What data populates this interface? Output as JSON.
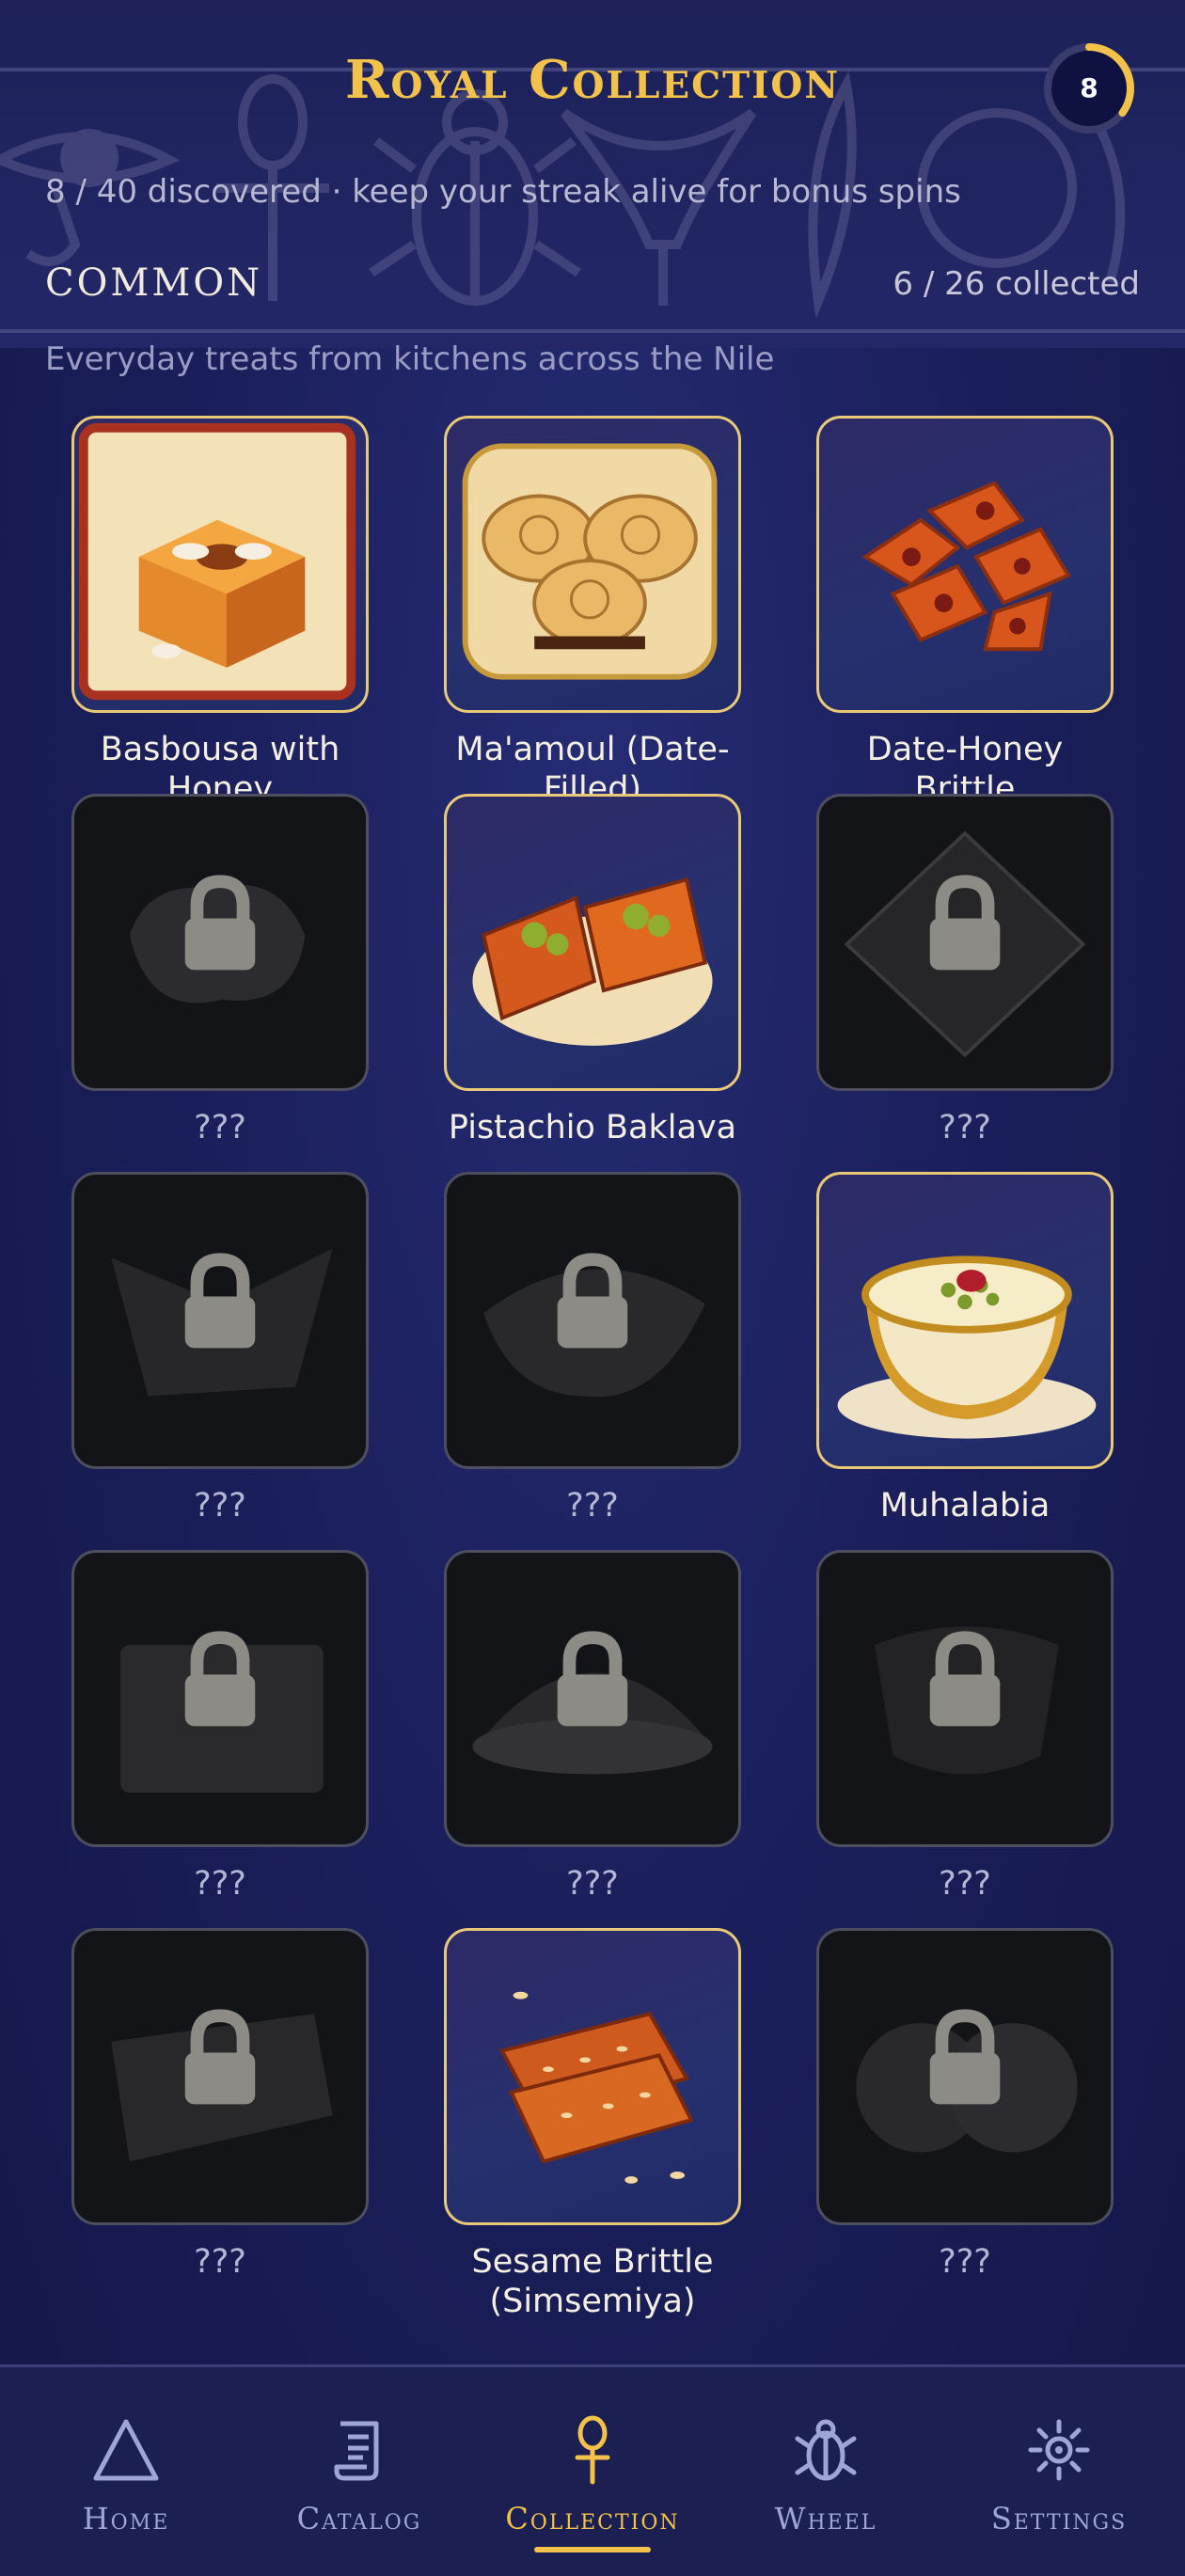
{
  "header": {
    "title": "Royal Collection",
    "streak_count": "8",
    "streak_progress": 0.35,
    "subtitle": "8 / 40 discovered · keep your streak alive for bonus spins"
  },
  "section": {
    "rarity": "COMMON",
    "collected": "6 / 26 collected",
    "description": "Everyday treats from kitchens across the Nile"
  },
  "items": [
    {
      "name": "Basbousa with Honey",
      "unlocked": true,
      "icon": "basbousa-icon"
    },
    {
      "name": "Ma'amoul (Date-Filled)",
      "unlocked": true,
      "icon": "maamoul-icon"
    },
    {
      "name": "Date-Honey Brittle",
      "unlocked": true,
      "icon": "brittle-icon"
    },
    {
      "name": "???",
      "unlocked": false,
      "icon": "lock-icon"
    },
    {
      "name": "Pistachio Baklava",
      "unlocked": true,
      "icon": "baklava-icon"
    },
    {
      "name": "???",
      "unlocked": false,
      "icon": "lock-icon"
    },
    {
      "name": "???",
      "unlocked": false,
      "icon": "lock-icon"
    },
    {
      "name": "???",
      "unlocked": false,
      "icon": "lock-icon"
    },
    {
      "name": "Muhalabia",
      "unlocked": true,
      "icon": "muhalabia-icon"
    },
    {
      "name": "???",
      "unlocked": false,
      "icon": "lock-icon"
    },
    {
      "name": "???",
      "unlocked": false,
      "icon": "lock-icon"
    },
    {
      "name": "???",
      "unlocked": false,
      "icon": "lock-icon"
    },
    {
      "name": "???",
      "unlocked": false,
      "icon": "lock-icon"
    },
    {
      "name": "Sesame Brittle (Simsemiya)",
      "unlocked": true,
      "icon": "sesame-brittle-icon"
    },
    {
      "name": "???",
      "unlocked": false,
      "icon": "lock-icon"
    }
  ],
  "nav": {
    "items": [
      {
        "label": "Home",
        "icon": "triangle-icon"
      },
      {
        "label": "Catalog",
        "icon": "scroll-icon"
      },
      {
        "label": "Collection",
        "icon": "ankh-icon",
        "active": true
      },
      {
        "label": "Wheel",
        "icon": "scarab-icon"
      },
      {
        "label": "Settings",
        "icon": "sun-gear-icon"
      }
    ]
  },
  "colors": {
    "accent_gold": "#f2c24a",
    "background": "#1b1f5c",
    "locked_tile": "#131418"
  }
}
